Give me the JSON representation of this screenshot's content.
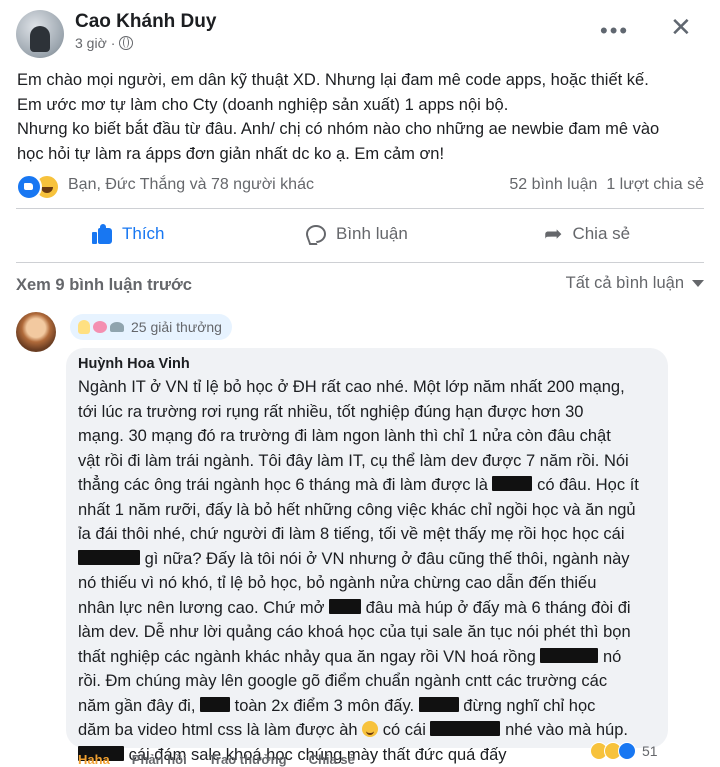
{
  "post": {
    "author": "Cao Khánh Duy",
    "time": "3 giờ",
    "more_icon": "more-horizontal-icon",
    "close_icon": "close-icon",
    "text_lines": [
      "Em chào mọi người, em dân kỹ thuật XD. Nhưng lại đam mê code apps, hoặc thiết kế.",
      "Em ước mơ tự làm cho Cty (doanh nghiệp sản xuất) 1 apps nội bộ.",
      "Nhưng ko biết  bắt đầu từ đâu. Anh/ chị có nhóm nào cho những ae newbie đam mê vào",
      "học hỏi tự làm ra ápps đơn giản nhất dc ko ạ. Em cảm ơn!"
    ],
    "reactions_text": "Bạn, Đức Thắng và 78 người khác",
    "comments_count": "52 bình luận",
    "shares_count": "1 lượt chia sẻ",
    "actions": {
      "like": "Thích",
      "comment": "Bình luận",
      "share": "Chia sẻ"
    },
    "see_previous": "Xem 9 bình luận trước",
    "all_comments": "Tất cả bình luận"
  },
  "comment": {
    "awards": "25 giải thưởng",
    "author": "Huỳnh Hoa Vinh",
    "lines": {
      "l1": "Ngành IT ở VN tỉ lệ bỏ học ở ĐH rất cao nhé. Một lớp năm nhất 200 mạng,",
      "l2": "tới lúc ra trường rơi rụng rất nhiều, tốt nghiệp đúng hạn được hơn 30",
      "l3": "mạng. 30 mạng đó ra trường đi làm ngon lành thì chỉ 1 nửa còn đâu chật",
      "l4": "vật rồi đi làm trái ngành. Tôi đây làm IT, cụ thể làm dev được 7 năm rồi. Nói",
      "l5a": "thẳng các ông trái ngành học 6 tháng mà đi làm được là",
      "l5b": "có đâu. Học ít",
      "l6": "nhất 1 năm rưỡi, đấy là bỏ hết những công việc khác chỉ ngồi học và ăn ngủ",
      "l7": "ỉa đái thôi nhé, chứ người đi làm 8 tiếng, tối về mệt thấy mẹ rồi học học cái",
      "l8b": "gì nữa? Đấy là tôi nói ở VN nhưng ở đâu cũng thế thôi, ngành này",
      "l9": "nó thiếu vì nó khó, tỉ lệ bỏ học, bỏ ngành nửa chừng cao dẫn đến thiếu",
      "l10a": "nhân lực nên lương cao. Chứ mở",
      "l10b": "đâu mà húp ở đấy mà 6 tháng đòi đi",
      "l11": "làm dev. Dễ như lời quảng cáo khoá học của tụi sale ăn tục nói phét thì bọn",
      "l12a": "thất nghiệp các ngành khác nhảy qua ăn ngay rồi VN hoá rồng",
      "l12b": "nó",
      "l13": "rồi. Đm chúng mày lên google gõ điểm chuẩn ngành cntt các trường các",
      "l14a": "năm gần đây đi,",
      "l14b": "toàn 2x điểm 3 môn đấy.",
      "l14c": "đừng nghĩ chỉ học",
      "l15a": "dăm ba video html css là làm được àh",
      "l15b": "có cái",
      "l15c": "nhé vào mà húp.",
      "l16b": "cái đám sale khoá học chúng mày thất đức quá đấy"
    },
    "reaction_count": "51",
    "actions": [
      "Haha",
      "Phản hồi",
      "Trao thưởng",
      "Chia sẻ"
    ]
  }
}
